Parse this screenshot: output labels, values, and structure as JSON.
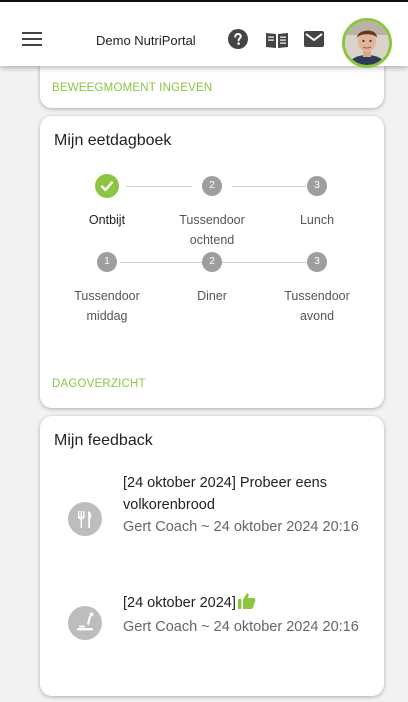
{
  "header": {
    "app_title": "Demo NutriPortal",
    "icons": [
      "menu-icon",
      "help-icon",
      "book-icon",
      "mail-icon",
      "avatar"
    ]
  },
  "card_movement": {
    "link": "BEWEEGMOMENT INGEVEN"
  },
  "card_diary": {
    "title": "Mijn eetdagboek",
    "steps_row1": [
      {
        "badge": "",
        "status": "done",
        "label": "Ontbijt"
      },
      {
        "badge": "2",
        "status": "pending",
        "label": "Tussendoor ochtend"
      },
      {
        "badge": "3",
        "status": "pending",
        "label": "Lunch"
      }
    ],
    "steps_row2": [
      {
        "badge": "1",
        "status": "pending",
        "label": "Tussendoor middag"
      },
      {
        "badge": "2",
        "status": "pending",
        "label": "Diner"
      },
      {
        "badge": "3",
        "status": "pending",
        "label": "Tussendoor avond"
      }
    ],
    "link": "DAGOVERZICHT"
  },
  "card_feedback": {
    "title": "Mijn feedback",
    "items": [
      {
        "icon": "cutlery-icon",
        "text": "[24 oktober 2024] Probeer eens volkorenbrood",
        "meta": "Gert Coach ~ 24 oktober 2024 20:16"
      },
      {
        "icon": "exercise-icon",
        "text": "[24 oktober 2024]",
        "meta": "Gert Coach ~ 24 oktober 2024 20:16"
      }
    ]
  },
  "colors": {
    "accent": "#8cc640",
    "step_pending": "#9e9e9e",
    "background": "#f2f2f2"
  }
}
